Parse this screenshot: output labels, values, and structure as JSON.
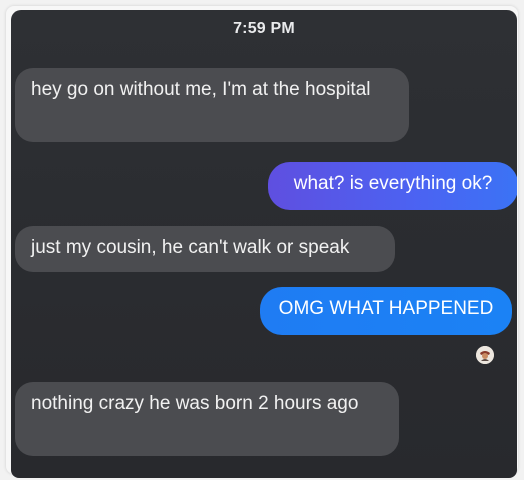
{
  "status_bar": {
    "time": "7:59 PM"
  },
  "messages": [
    {
      "direction": "incoming",
      "text": "hey go on without me, I'm at the hospital"
    },
    {
      "direction": "outgoing",
      "text": "what? is everything ok?"
    },
    {
      "direction": "incoming",
      "text": "just my cousin, he can't walk or speak"
    },
    {
      "direction": "outgoing",
      "text": "OMG WHAT HAPPENED"
    },
    {
      "direction": "incoming",
      "text": "nothing crazy he was born 2 hours ago"
    }
  ],
  "read_receipt": {
    "icon": "avatar-read-receipt-icon"
  },
  "colors": {
    "background": "#2b2d31",
    "incoming_bubble": "#4b4c50",
    "outgoing_bubble_gradient_start": "#5f4fe0",
    "outgoing_bubble_blue": "#1f7cf3"
  }
}
